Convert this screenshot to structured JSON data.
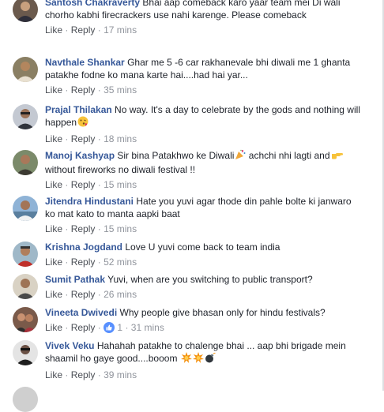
{
  "like_label": "Like",
  "reply_label": "Reply",
  "separator": "·",
  "comments": [
    {
      "name": "Santosh Chakraverty",
      "text": "Bhai aap comeback karo yaar team mei Di wali chorho kabhi firecrackers use nahi karenge. Please comeback",
      "time": "17 mins"
    },
    {
      "name": "Navthale Shankar",
      "text": "Ghar me 5 -6 car rakhanevale bhi diwali me 1 ghanta patakhe fodne ko mana karte hai....had hai yar...",
      "time": "35 mins"
    },
    {
      "name": "Prajal Thilakan",
      "text": "No way. It's a day to celebrate by the gods and nothing will happen",
      "emoji": "kiss-emoji",
      "time": "18 mins"
    },
    {
      "name": "Manoj Kashyap",
      "text_a": "Sir bina Patakhwo ke Diwali",
      "emoji_a": "party-popper-emoji",
      "text_b": " achchi nhi lagti and",
      "emoji_b": "pointing-hand-emoji",
      "text_c": " without fireworks no diwali festival !!",
      "time": "15 mins"
    },
    {
      "name": "Jitendra Hindustani",
      "text": "Hate you yuvi agar thode din pahle bolte ki janwaro ko mat kato to manta aapki baat",
      "time": "15 mins"
    },
    {
      "name": "Krishna Jogdand",
      "text": "Love U yuvi come back to team india",
      "time": "52 mins"
    },
    {
      "name": "Sumit Pathak",
      "text": "Yuvi, when are you switching to public transport?",
      "time": "26 mins"
    },
    {
      "name": "Vineeta Dwivedi",
      "text": "Why people give bhasan only for hindu festivals?",
      "time": "31 mins",
      "likes": "1"
    },
    {
      "name": "Vivek Veku",
      "text": "Hahahah patakhe to chalenge bhai ... aap bhi brigade mein shaamil ho gaye good....booom",
      "emojis": [
        "explosion-emoji",
        "explosion-emoji",
        "bomb-emoji"
      ],
      "time": "39 mins"
    }
  ]
}
